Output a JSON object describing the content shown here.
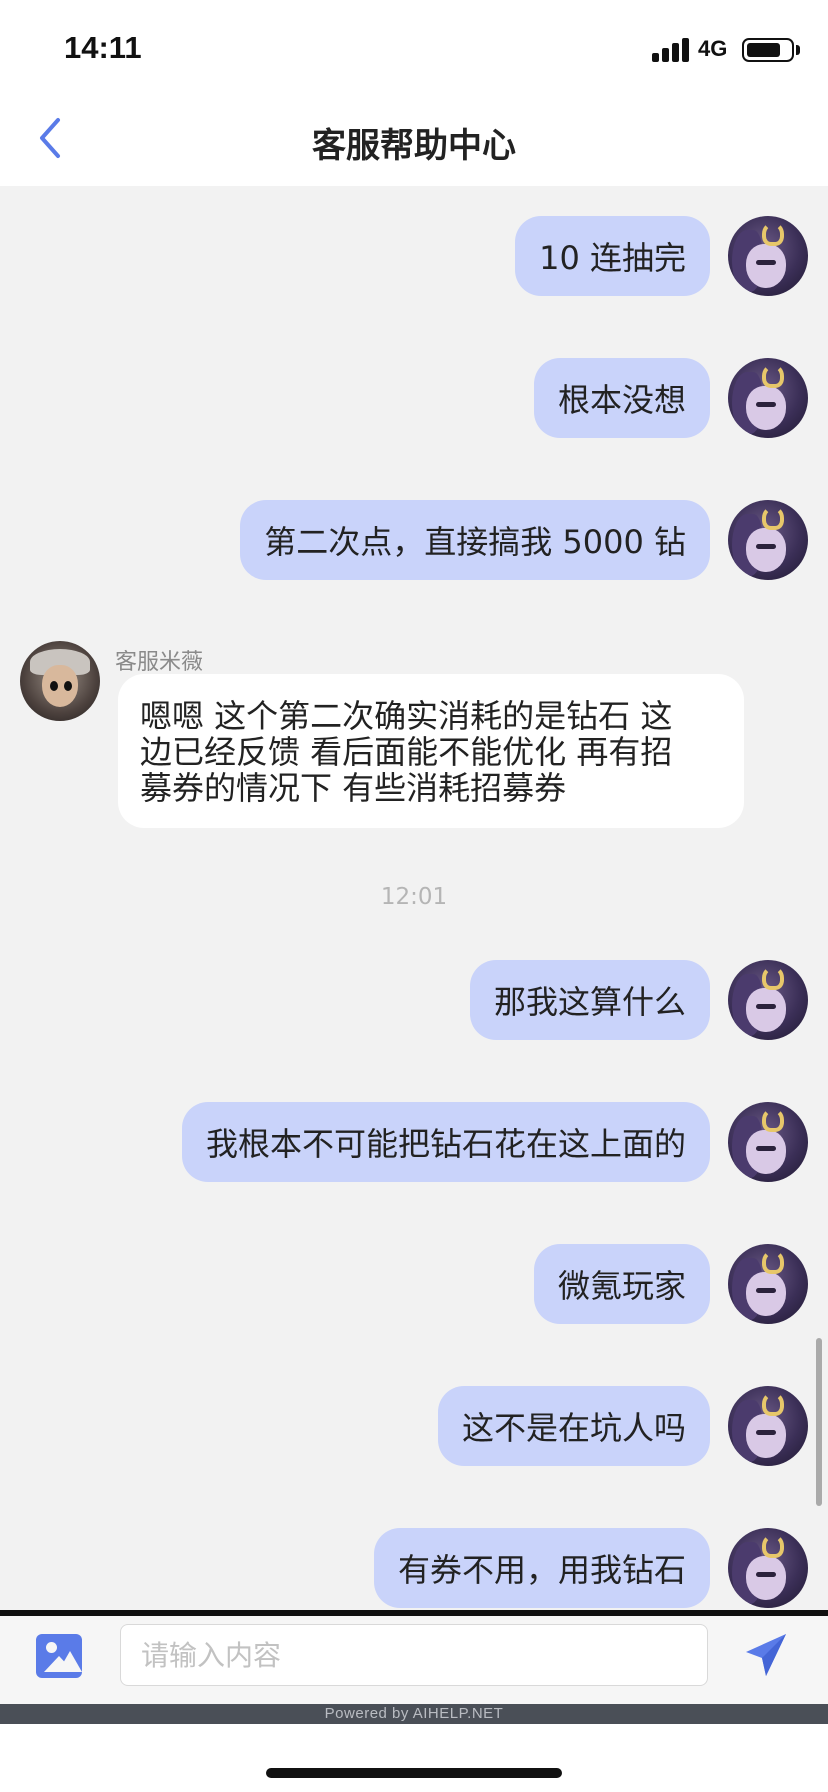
{
  "status_bar": {
    "time": "14:11",
    "network": "4G",
    "battery_level": 0.8
  },
  "header": {
    "title": "客服帮助中心",
    "back_icon": "chevron-left-icon"
  },
  "messages_before": [
    {
      "sender": "user",
      "text": "10 连抽完"
    },
    {
      "sender": "user",
      "text": "根本没想"
    },
    {
      "sender": "user",
      "text": "第二次点，直接搞我 5000 钻"
    }
  ],
  "agent_message": {
    "name": "客服米薇",
    "lines": [
      "嗯嗯 这个第二次确实消耗的是钻石  这",
      "边已经反馈 看后面能不能优化 再有招",
      "募券的情况下 有些消耗招募券"
    ]
  },
  "timestamp": "12:01",
  "messages_after": [
    {
      "sender": "user",
      "text": "那我这算什么"
    },
    {
      "sender": "user",
      "text": "我根本不可能把钻石花在这上面的"
    },
    {
      "sender": "user",
      "text": "微氪玩家"
    },
    {
      "sender": "user",
      "text": "这不是在坑人吗"
    },
    {
      "sender": "user",
      "text": "有券不用，用我钻石"
    }
  ],
  "input": {
    "placeholder": "请输入内容",
    "value": ""
  },
  "footer": {
    "powered_by": "Powered by AIHELP.NET"
  },
  "colors": {
    "accent": "#5a7be8",
    "user_bubble": "#c9d3fa",
    "chat_background": "#f2f2f2"
  }
}
